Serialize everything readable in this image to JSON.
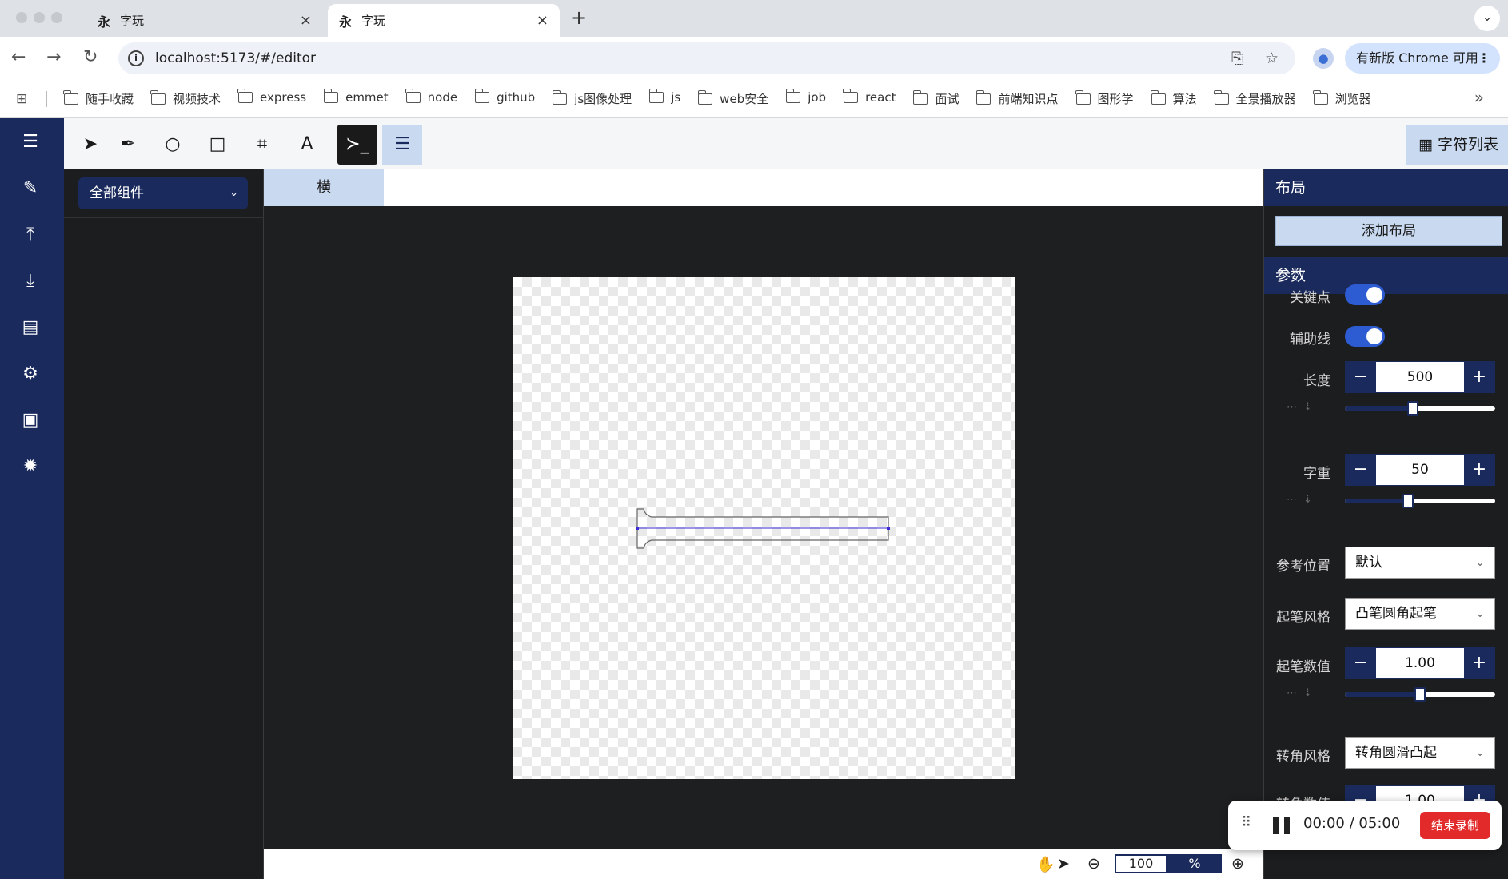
{
  "browser": {
    "tabs": [
      {
        "favicon": "永",
        "title": "字玩",
        "close": "×"
      },
      {
        "favicon": "永",
        "title": "字玩",
        "close": "×"
      }
    ],
    "new_tab": "+",
    "tab_menu": "⌄",
    "url": "localhost:5173/#/editor",
    "update_label": "有新版 Chrome 可用",
    "update_menu": "⋮",
    "bookmarks": [
      "随手收藏",
      "视频技术",
      "express",
      "emmet",
      "node",
      "github",
      "js图像处理",
      "js",
      "web安全",
      "job",
      "react",
      "面试",
      "前端知识点",
      "图形学",
      "算法",
      "全景播放器",
      "浏览器"
    ],
    "bookmarks_more": "»"
  },
  "toolbar": {
    "tools": [
      {
        "icon": "select-arrow-icon",
        "glyph": "➤"
      },
      {
        "icon": "pen-icon",
        "glyph": "✒"
      },
      {
        "icon": "ellipse-icon",
        "glyph": "○"
      },
      {
        "icon": "rectangle-icon",
        "glyph": "□"
      },
      {
        "icon": "polygon-icon",
        "glyph": "⌗"
      },
      {
        "icon": "text-icon",
        "glyph": "A"
      },
      {
        "icon": "terminal-icon",
        "glyph": "≻_"
      },
      {
        "icon": "sliders-icon",
        "glyph": "☰"
      }
    ],
    "char_list_icon": "▦",
    "char_list_label": "字符列表"
  },
  "left_panel": {
    "filter_value": "全部组件",
    "filter_arrow": "⌄"
  },
  "canvas": {
    "tab_label": "横",
    "zoom_value": "100",
    "zoom_unit": "%"
  },
  "right_panel": {
    "layout_title": "布局",
    "add_layout_label": "添加布局",
    "params_title": "参数",
    "keypoint_label": "关键点",
    "keypoint_on": true,
    "guide_label": "辅助线",
    "guide_on": true,
    "length_label": "长度",
    "length_value": "500",
    "length_level": 0.45,
    "weight_label": "字重",
    "weight_value": "50",
    "weight_level": 0.42,
    "ref_pos_label": "参考位置",
    "ref_pos_value": "默认",
    "start_style_label": "起笔风格",
    "start_style_value": "凸笔圆角起笔",
    "start_value_label": "起笔数值",
    "start_value": "1.00",
    "start_value_level": 0.5,
    "corner_style_label": "转角风格",
    "corner_style_value": "转角圆滑凸起",
    "corner_value_label": "转角数值",
    "corner_value": "1.00",
    "minus": "−",
    "plus": "+",
    "slider_aux": "⋯ ⇣"
  },
  "recording": {
    "elapsed": "00:00",
    "separator": "/",
    "total": "05:00",
    "stop_label": "结束录制"
  },
  "colors": {
    "sidebar": "#1a2a5c",
    "accent_light": "#c8d9f0",
    "toggle_on": "#2d5bd1",
    "stop_button": "#e32a2a"
  }
}
